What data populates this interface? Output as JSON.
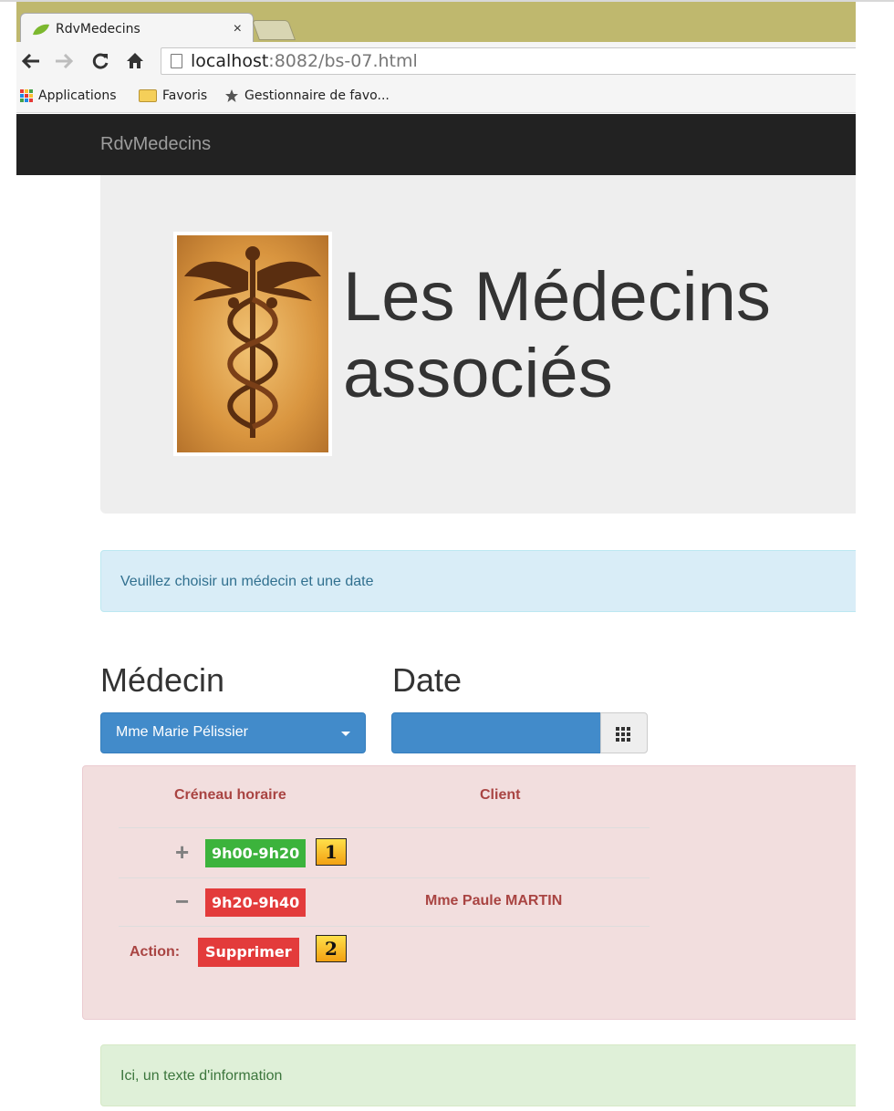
{
  "browser": {
    "tab_title": "RdvMedecins",
    "tab_close": "×",
    "url_host": "localhost",
    "url_rest": ":8082/bs-07.html",
    "bookmarks": [
      "Applications",
      "Favoris",
      "Gestionnaire de favo..."
    ]
  },
  "navbar": {
    "brand": "RdvMedecins"
  },
  "jumbotron": {
    "title_line1": "Les Médecins",
    "title_line2": "associés"
  },
  "info_alert": "Veuillez choisir un médecin et une date",
  "form": {
    "medecin_label": "Médecin",
    "date_label": "Date",
    "medecin_selected": "Mme Marie Pélissier"
  },
  "agenda": {
    "headers": {
      "slot": "Créneau horaire",
      "client": "Client"
    },
    "rows": [
      {
        "sign": "+",
        "slot": "9h00-9h20",
        "client": "",
        "status_color": "#3cb33c"
      },
      {
        "sign": "−",
        "slot": "9h20-9h40",
        "client": "Mme Paule MARTIN",
        "status_color": "#e33b3b"
      }
    ],
    "action_label": "Action:",
    "action_button": "Supprimer",
    "markers": [
      "1",
      "2"
    ]
  },
  "success_alert": "Ici, un texte d'information",
  "colors": {
    "primary": "#428bca",
    "navbar": "#222222",
    "danger_text": "#a94442",
    "free": "#3cb33c",
    "busy": "#e33b3b"
  }
}
